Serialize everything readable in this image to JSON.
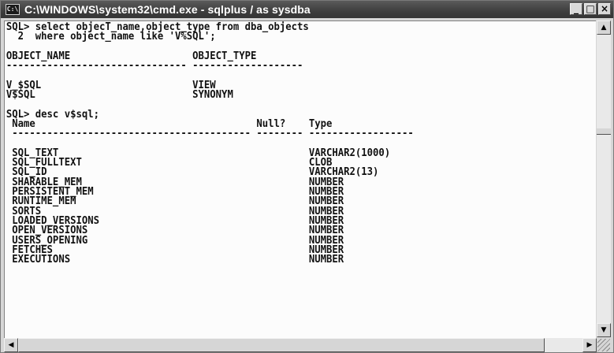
{
  "window": {
    "title": "C:\\WINDOWS\\system32\\cmd.exe - sqlplus / as sysdba",
    "icon": "cmd-icon"
  },
  "title_buttons": {
    "minimize": "_",
    "maximize": "□",
    "close": "×"
  },
  "console": {
    "lines": [
      "SQL> select objecT_name,object_type from dba_objects",
      "  2  where object_name like 'V%SQL';",
      "",
      "OBJECT_NAME                     OBJECT_TYPE",
      "------------------------------- -------------------",
      "",
      "V_$SQL                          VIEW",
      "V$SQL                           SYNONYM",
      "",
      "SQL> desc v$sql;",
      " Name                                      Null?    Type",
      " ----------------------------------------- -------- ------------------",
      "",
      " SQL_TEXT                                           VARCHAR2(1000)",
      " SQL_FULLTEXT                                       CLOB",
      " SQL_ID                                             VARCHAR2(13)",
      " SHARABLE_MEM                                       NUMBER",
      " PERSISTENT_MEM                                     NUMBER",
      " RUNTIME_MEM                                        NUMBER",
      " SORTS                                              NUMBER",
      " LOADED_VERSIONS                                    NUMBER",
      " OPEN_VERSIONS                                      NUMBER",
      " USERS_OPENING                                      NUMBER",
      " FETCHES                                            NUMBER",
      " EXECUTIONS                                         NUMBER"
    ]
  },
  "scrollbar": {
    "up": "▲",
    "down": "▼",
    "left": "◀",
    "right": "▶"
  }
}
